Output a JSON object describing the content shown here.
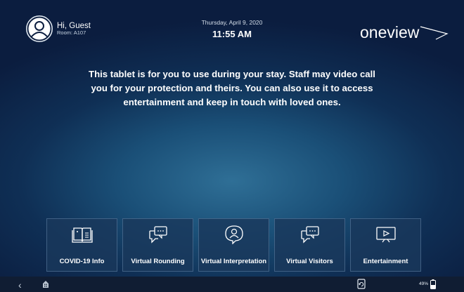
{
  "header": {
    "greeting": "Hi, Guest",
    "room": "Room: A107",
    "date": "Thursday, April 9, 2020",
    "time": "11:55 AM",
    "logo": "oneview"
  },
  "message": "This tablet is for you to use during your stay. Staff may video call you for your protection and theirs. You can also use it to access entertainment and keep in touch with loved ones.",
  "tiles": [
    {
      "label": "COVID-19 Info",
      "icon": "covid-info-book-icon"
    },
    {
      "label": "Virtual Rounding",
      "icon": "chat-bubble-icon"
    },
    {
      "label": "Virtual Interpretation",
      "icon": "interpreter-person-icon"
    },
    {
      "label": "Virtual Visitors",
      "icon": "chat-bubble-icon"
    },
    {
      "label": "Entertainment",
      "icon": "tv-play-icon"
    }
  ],
  "system_bar": {
    "battery_percent": "49%",
    "battery_level": 0.49
  },
  "colors": {
    "background_top": "#0b1d3f",
    "background_glow": "#2f6f96",
    "tile_bg": "#1a385c",
    "nav_bar": "#101d33"
  }
}
